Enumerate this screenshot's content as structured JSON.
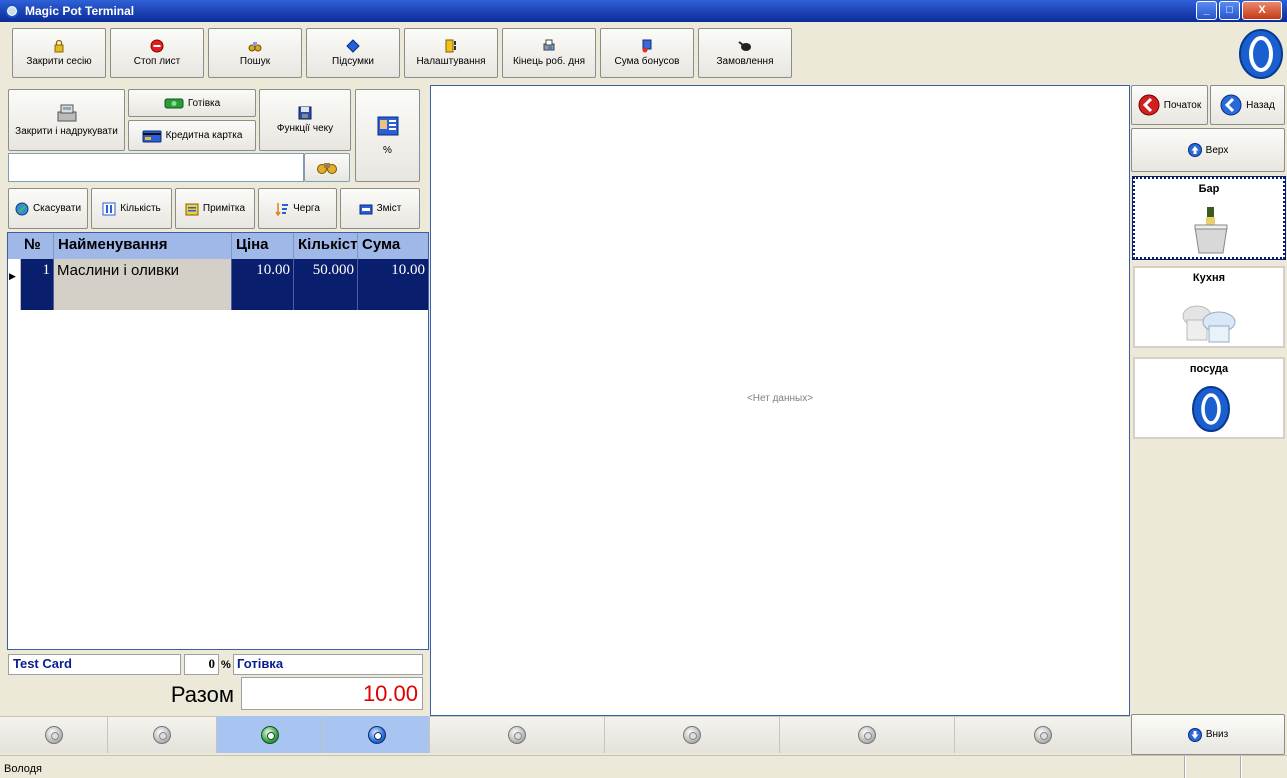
{
  "window": {
    "title": "Magic Pot Terminal"
  },
  "toolbar": [
    {
      "label": "Закрити сесію",
      "icon": "lock-icon"
    },
    {
      "label": "Стоп лист",
      "icon": "stop-icon"
    },
    {
      "label": "Пошук",
      "icon": "binoculars-icon"
    },
    {
      "label": "Підсумки",
      "icon": "diamond-icon"
    },
    {
      "label": "Налаштування",
      "icon": "settings-icon"
    },
    {
      "label": "Кінець роб. дня",
      "icon": "printer-icon"
    },
    {
      "label": "Сума бонусов",
      "icon": "bonus-icon"
    },
    {
      "label": "Замовлення",
      "icon": "pan-icon"
    }
  ],
  "check": {
    "close_print": "Закрити і надрукувати",
    "cash": "Готівка",
    "credit_card": "Кредитна картка",
    "check_functions": "Функції чеку",
    "percent": "%",
    "search_value": ""
  },
  "actions": {
    "cancel": "Скасувати",
    "quantity": "Кількість",
    "note": "Примітка",
    "queue": "Черга",
    "content": "Зміст"
  },
  "grid": {
    "columns": [
      "№",
      "Найменування",
      "Ціна",
      "Кількість",
      "Сума"
    ],
    "rows": [
      {
        "num": "1",
        "name": "Маслини і оливки",
        "price": "10.00",
        "qty": "50.000",
        "sum": "10.00"
      }
    ]
  },
  "footer": {
    "card": "Test Card",
    "discount": "0",
    "percent": "%",
    "payment": "Готівка",
    "total_label": "Разом",
    "total_value": "10.00"
  },
  "center": {
    "empty": "<Нет данных>"
  },
  "right": {
    "start": "Початок",
    "back": "Назад",
    "up": "Верх",
    "down": "Вниз",
    "categories": [
      {
        "label": "Бар"
      },
      {
        "label": "Кухня"
      },
      {
        "label": "посуда"
      }
    ]
  },
  "status": {
    "user": "Володя"
  },
  "colors": {
    "selection": "#0a1e6e",
    "total": "#e00000",
    "header": "#9fb8e8"
  }
}
